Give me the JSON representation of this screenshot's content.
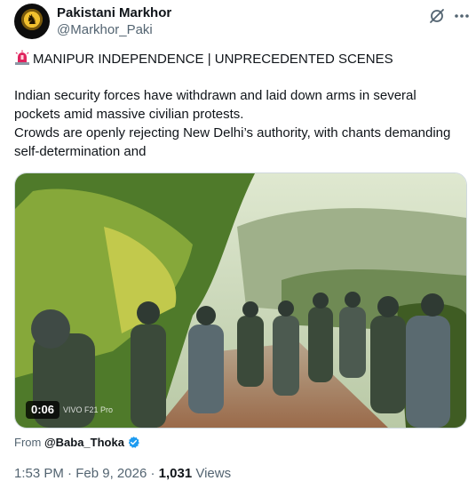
{
  "author": {
    "display_name": "Pakistani Markhor",
    "handle": "@Markhor_Paki"
  },
  "icons": {
    "avatar": "markhor-avatar",
    "grok": "grok-icon",
    "more": "more-dots-icon",
    "headline": "siren-icon",
    "verified": "verified-badge-icon"
  },
  "post": {
    "headline": "MANIPUR INDEPENDENCE | UNPRECEDENTED SCENES",
    "paragraphs": [
      "Indian security forces have withdrawn and laid down arms in several pockets amid massive civilian protests.",
      "Crowds are openly rejecting New Delhi’s authority, with chants demanding self-determination and"
    ]
  },
  "media": {
    "duration": "0:06",
    "watermark": "VIVO F21 Pro"
  },
  "attribution": {
    "prefix": "From",
    "source_handle": "@Baba_Thoka"
  },
  "meta": {
    "time": "1:53 PM",
    "separator": "·",
    "date": "Feb 9, 2026",
    "views_count": "1,031",
    "views_label": "Views"
  },
  "colors": {
    "text_primary": "#0f1419",
    "text_secondary": "#536471",
    "verified_blue": "#1d9bf0",
    "siren_red": "#e0245e"
  }
}
